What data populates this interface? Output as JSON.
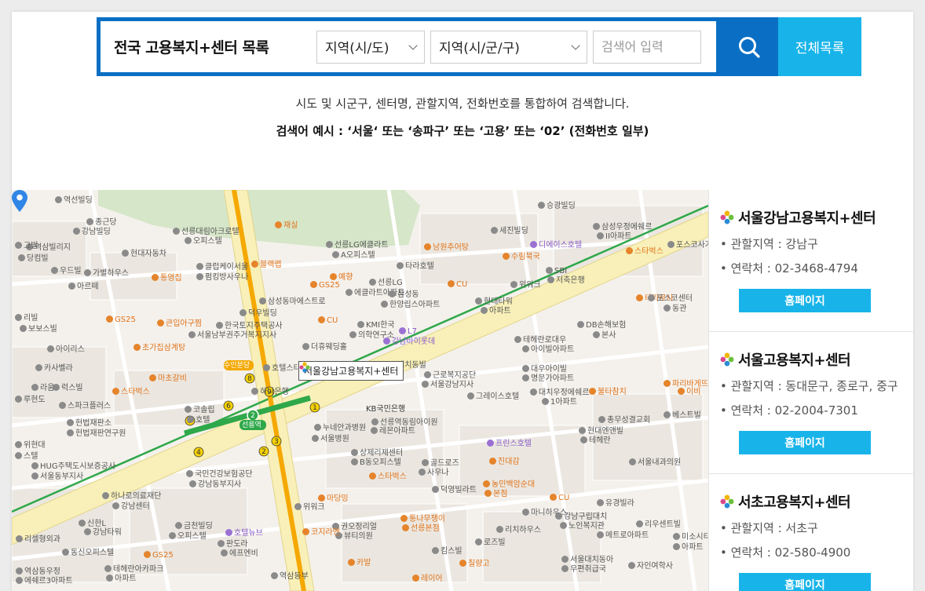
{
  "search": {
    "title": "전국 고용복지+센터 목록",
    "region1": "지역(시/도)",
    "region2": "지역(시/군/구)",
    "placeholder": "검색어 입력",
    "all_label": "전체목록"
  },
  "description": {
    "line1": "시도 및 시군구, 센터명, 관할지역, 전화번호를 통합하여 검색합니다.",
    "line2": "검색어 예시 : ‘서울‘ 또는 ‘송파구’ 또는 ‘고용’ 또는 ‘02’ (전화번호 일부)"
  },
  "map": {
    "selected_label": "서울강남고용복지+센터",
    "pin_label": "KB국민은행",
    "station_badge": "수인분당",
    "station_name": "선릉역",
    "pois": [
      {
        "t": "역선빌딩",
        "c": ""
      },
      {
        "t": "종근당",
        "c": ""
      },
      {
        "t": "강남빌딩",
        "c": ""
      },
      {
        "t": "역삼빌리지",
        "c": ""
      },
      {
        "t": "당컴빌",
        "c": ""
      },
      {
        "t": "우드빌",
        "c": ""
      },
      {
        "t": "가별하우스",
        "c": ""
      },
      {
        "t": "아르떼",
        "c": ""
      },
      {
        "t": "현대자동차",
        "c": ""
      },
      {
        "t": "통영집",
        "c": "o"
      },
      {
        "t": "선릉대림아크로텔",
        "c": ""
      },
      {
        "t": "오피스텔",
        "c": ""
      },
      {
        "t": "클럽케이서울",
        "c": ""
      },
      {
        "t": "펌킹방사우나",
        "c": ""
      },
      {
        "t": "블랙랩",
        "c": "o"
      },
      {
        "t": "재실",
        "c": "o"
      },
      {
        "t": "선릉LG에클라트",
        "c": ""
      },
      {
        "t": "A오피스텔",
        "c": ""
      },
      {
        "t": "예향",
        "c": "o"
      },
      {
        "t": "GS25",
        "c": "o"
      },
      {
        "t": "선릉LG",
        "c": ""
      },
      {
        "t": "에클라트아파트",
        "c": ""
      },
      {
        "t": "타라호텔",
        "c": ""
      },
      {
        "t": "남원추어탕",
        "c": "o"
      },
      {
        "t": "세진빌딩",
        "c": ""
      },
      {
        "t": "디에이스호텔",
        "c": "p"
      },
      {
        "t": "수림북국",
        "c": "o"
      },
      {
        "t": "승광빌딩",
        "c": ""
      },
      {
        "t": "삼성우정에쉐르",
        "c": ""
      },
      {
        "t": "II아파트",
        "c": ""
      },
      {
        "t": "스타벅스",
        "c": "o"
      },
      {
        "t": "SBI",
        "c": ""
      },
      {
        "t": "저축은행",
        "c": ""
      },
      {
        "t": "포스코사거리",
        "c": ""
      },
      {
        "t": "CU",
        "c": "o"
      },
      {
        "t": "삼성동",
        "c": ""
      },
      {
        "t": "한양립스아파트",
        "c": ""
      },
      {
        "t": "위워크",
        "c": ""
      },
      {
        "t": "현대타워",
        "c": ""
      },
      {
        "t": "아파트",
        "c": ""
      },
      {
        "t": "테라로사",
        "c": "o"
      },
      {
        "t": "포스코센터",
        "c": ""
      },
      {
        "t": "동관",
        "c": ""
      },
      {
        "t": "덕우빌딩",
        "c": ""
      },
      {
        "t": "삼성동마에스트로",
        "c": ""
      },
      {
        "t": "GS25",
        "c": "o"
      },
      {
        "t": "큰입아구찜",
        "c": "o"
      },
      {
        "t": "한국토지주택공사",
        "c": ""
      },
      {
        "t": "서울남부권주거복지지사",
        "c": ""
      },
      {
        "t": "CU",
        "c": "o"
      },
      {
        "t": "KMI한국",
        "c": ""
      },
      {
        "t": "의학연구소",
        "c": ""
      },
      {
        "t": "L7",
        "c": "p"
      },
      {
        "t": "강남바이롯데",
        "c": "p"
      },
      {
        "t": "테헤란로대우",
        "c": ""
      },
      {
        "t": "아이빌아파트",
        "c": ""
      },
      {
        "t": "DB손해보험",
        "c": ""
      },
      {
        "t": "본사",
        "c": ""
      },
      {
        "t": "보보스빌",
        "c": ""
      },
      {
        "t": "아이리스",
        "c": ""
      },
      {
        "t": "초가집삼계탕",
        "c": "o"
      },
      {
        "t": "더휴웨딩홀",
        "c": ""
      },
      {
        "t": "카사벨라",
        "c": ""
      },
      {
        "t": "마초갈비",
        "c": "o"
      },
      {
        "t": "호텔스타",
        "c": ""
      },
      {
        "t": "근로복지공단",
        "c": ""
      },
      {
        "t": "서울강남지사",
        "c": ""
      },
      {
        "t": "대우아이빌",
        "c": ""
      },
      {
        "t": "명문가아파트",
        "c": ""
      },
      {
        "t": "라움",
        "c": ""
      },
      {
        "t": "럭스빌",
        "c": ""
      },
      {
        "t": "스타벅스",
        "c": "o"
      },
      {
        "t": "하나은행",
        "c": ""
      },
      {
        "t": "그레이스호텔",
        "c": ""
      },
      {
        "t": "대치우정에쉐르",
        "c": ""
      },
      {
        "t": "1아파트",
        "c": ""
      },
      {
        "t": "불타참치",
        "c": "o"
      },
      {
        "t": "파리바게뜨",
        "c": "o"
      },
      {
        "t": "스파크플러스",
        "c": ""
      },
      {
        "t": "코솔립",
        "c": ""
      },
      {
        "t": "호텔",
        "c": ""
      },
      {
        "t": "총무성결교회",
        "c": ""
      },
      {
        "t": "헌법재판소",
        "c": ""
      },
      {
        "t": "헌법재판연구원",
        "c": ""
      },
      {
        "t": "누네안과병원",
        "c": ""
      },
      {
        "t": "서울병원",
        "c": ""
      },
      {
        "t": "선릉역동림아이원",
        "c": ""
      },
      {
        "t": "레몬아파트",
        "c": ""
      },
      {
        "t": "현대엔앤빌",
        "c": ""
      },
      {
        "t": "테헤란",
        "c": ""
      },
      {
        "t": "프린스호텔",
        "c": "p"
      },
      {
        "t": "상제리제센터",
        "c": ""
      },
      {
        "t": "B동오피스텔",
        "c": ""
      },
      {
        "t": "스타벅스",
        "c": "o"
      },
      {
        "t": "골드로즈",
        "c": ""
      },
      {
        "t": "사우나",
        "c": ""
      },
      {
        "t": "진대감",
        "c": "o"
      },
      {
        "t": "서울내과의원",
        "c": ""
      },
      {
        "t": "HUG주택도시보증공사",
        "c": ""
      },
      {
        "t": "서울동부지사",
        "c": ""
      },
      {
        "t": "국민건강보험공단",
        "c": ""
      },
      {
        "t": "강남동부지사",
        "c": ""
      },
      {
        "t": "덕영빌라트",
        "c": ""
      },
      {
        "t": "농민백암순대",
        "c": "o"
      },
      {
        "t": "본점",
        "c": "o"
      },
      {
        "t": "하나로의료재단",
        "c": ""
      },
      {
        "t": "강남센터",
        "c": ""
      },
      {
        "t": "마당밍",
        "c": "o"
      },
      {
        "t": "CU",
        "c": "o"
      },
      {
        "t": "마니하우스",
        "c": ""
      },
      {
        "t": "유경빌라",
        "c": ""
      },
      {
        "t": "신한L",
        "c": ""
      },
      {
        "t": "강남타워",
        "c": ""
      },
      {
        "t": "위워크",
        "c": ""
      },
      {
        "t": "권오정리얼",
        "c": ""
      },
      {
        "t": "뷰티의원",
        "c": ""
      },
      {
        "t": "통나무쟁이",
        "c": "o"
      },
      {
        "t": "선릉본점",
        "c": "o"
      },
      {
        "t": "강남구립대치",
        "c": ""
      },
      {
        "t": "노인복지관",
        "c": ""
      },
      {
        "t": "리우센트빌",
        "c": ""
      },
      {
        "t": "금천빌딩",
        "c": ""
      },
      {
        "t": "오피스텔",
        "c": ""
      },
      {
        "t": "호텔뉴브",
        "c": "p"
      },
      {
        "t": "코지라엔",
        "c": "o"
      },
      {
        "t": "리치하우스",
        "c": ""
      },
      {
        "t": "메트로아파트",
        "c": ""
      },
      {
        "t": "미소시티",
        "c": ""
      },
      {
        "t": "아파트",
        "c": ""
      },
      {
        "t": "리셀형외과",
        "c": ""
      },
      {
        "t": "동신오피스텔",
        "c": ""
      },
      {
        "t": "GS25",
        "c": "o"
      },
      {
        "t": "판도라",
        "c": ""
      },
      {
        "t": "에프엔비",
        "c": ""
      },
      {
        "t": "카발",
        "c": "o"
      },
      {
        "t": "킴스빌",
        "c": ""
      },
      {
        "t": "로즈빌",
        "c": ""
      },
      {
        "t": "칠량고",
        "c": "o"
      },
      {
        "t": "서울대치동아",
        "c": ""
      },
      {
        "t": "우편취급국",
        "c": ""
      },
      {
        "t": "자인여학사",
        "c": ""
      },
      {
        "t": "역삼동우정",
        "c": ""
      },
      {
        "t": "에쉐르3아파트",
        "c": ""
      },
      {
        "t": "테헤란아카파크",
        "c": ""
      },
      {
        "t": "아파트",
        "c": ""
      },
      {
        "t": "역삼동부",
        "c": ""
      },
      {
        "t": "레이어",
        "c": "o"
      },
      {
        "t": "베스트빌",
        "c": ""
      },
      {
        "t": "이비",
        "c": "o"
      },
      {
        "t": "그빌",
        "c": ""
      },
      {
        "t": "리빌",
        "c": ""
      },
      {
        "t": "대치동빌",
        "c": ""
      },
      {
        "t": "루현도",
        "c": ""
      },
      {
        "t": "위현대",
        "c": ""
      },
      {
        "t": "스텔",
        "c": ""
      }
    ]
  },
  "centers": [
    {
      "name": "서울강남고용복지+센터",
      "area": "관할지역 : 강남구",
      "phone": "연락처 : 02-3468-4794",
      "homepage": "홈페이지"
    },
    {
      "name": "서울고용복지+센터",
      "area": "관할지역 : 동대문구, 종로구, 중구",
      "phone": "연락처 : 02-2004-7301",
      "homepage": "홈페이지"
    },
    {
      "name": "서초고용복지+센터",
      "area": "관할지역 : 서초구",
      "phone": "연락처 : 02-580-4900",
      "homepage": "홈페이지"
    }
  ],
  "colors": {
    "accent_dark": "#0a6fc4",
    "accent_light": "#18b4e9",
    "subway_green": "#2ea84a",
    "subway_yellow": "#f5a800"
  }
}
